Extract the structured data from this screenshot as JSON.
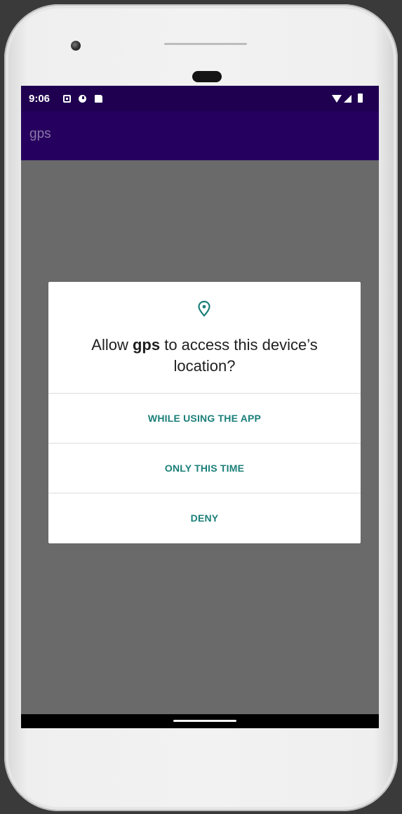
{
  "status_bar": {
    "time": "9:06",
    "notification_icons": [
      "notification-a-icon",
      "notification-circle-icon",
      "sd-card-icon"
    ],
    "system_icons": [
      "wifi-icon",
      "signal-icon",
      "battery-icon"
    ]
  },
  "app_bar": {
    "title": "gps"
  },
  "permission_dialog": {
    "icon": "location-pin-icon",
    "title_prefix": "Allow ",
    "app_name": "gps",
    "title_suffix": " to access this device’s location?",
    "options": [
      {
        "label": "WHILE USING THE APP"
      },
      {
        "label": "ONLY THIS TIME"
      },
      {
        "label": "DENY"
      }
    ]
  },
  "colors": {
    "status_bar": "#1f0050",
    "app_bar": "#26005e",
    "scrim": "#6a6a6a",
    "accent": "#1b7f79"
  }
}
